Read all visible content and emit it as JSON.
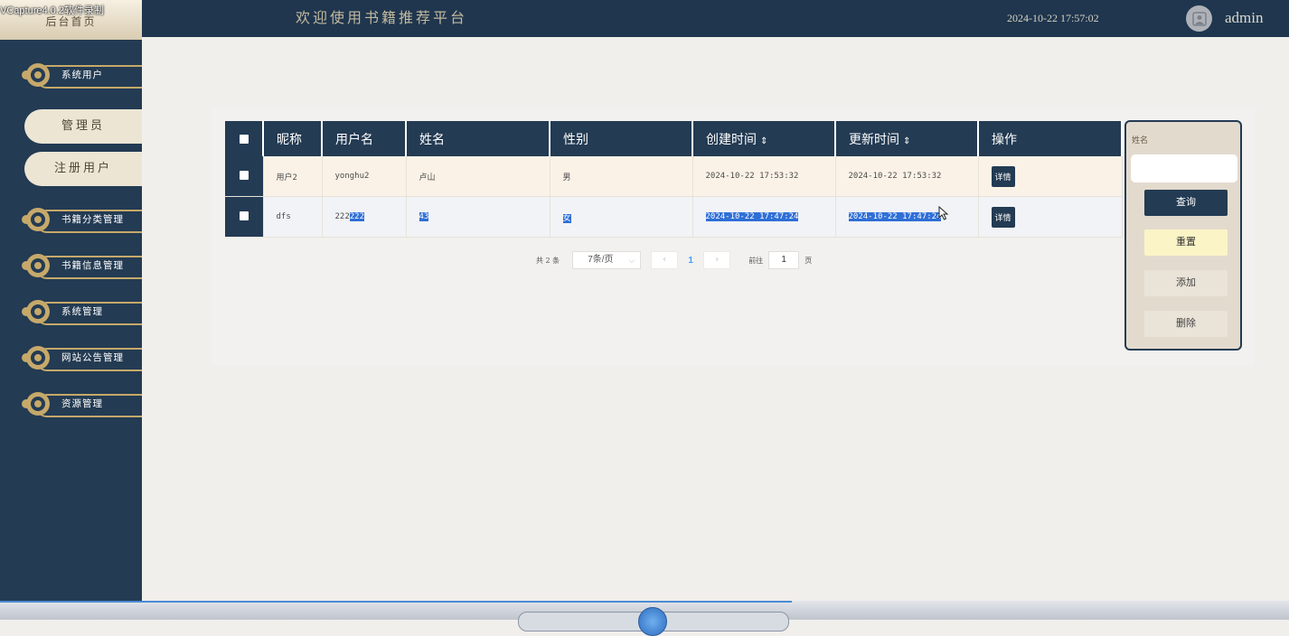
{
  "watermark": "VCapture4.0.2软件录制",
  "sidebar": {
    "home_tab": "后台首页",
    "menu": [
      {
        "label": "系统用户"
      },
      {
        "label": "书籍分类管理"
      },
      {
        "label": "书籍信息管理"
      },
      {
        "label": "系统管理"
      },
      {
        "label": "网站公告管理"
      },
      {
        "label": "资源管理"
      }
    ],
    "sub_items": [
      {
        "label": "管理员"
      },
      {
        "label": "注册用户"
      }
    ]
  },
  "header": {
    "title": "欢迎使用书籍推荐平台",
    "datetime": "2024-10-22 17:57:02",
    "username": "admin"
  },
  "table": {
    "columns": [
      "昵称",
      "用户名",
      "姓名",
      "性别",
      "创建时间",
      "更新时间",
      "操作"
    ],
    "sort_icon": "⇕",
    "rows": [
      {
        "nickname": "用户2",
        "username": "yonghu2",
        "name": "卢山",
        "gender": "男",
        "created": "2024-10-22 17:53:32",
        "updated": "2024-10-22 17:53:32",
        "action": "详情"
      },
      {
        "nickname": "dfs",
        "username_a": "222",
        "username_b": "222",
        "name": "43",
        "gender": "女",
        "created": "2024-10-22 17:47:24",
        "updated": "2024-10-22 17:47:24",
        "action": "详情"
      }
    ]
  },
  "pagination": {
    "total": "共 2 条",
    "page_size": "7条/页",
    "current_page": "1",
    "goto_label": "前往",
    "goto_value": "1",
    "page_suffix": "页"
  },
  "search_panel": {
    "label": "姓名",
    "input_value": "",
    "query": "查询",
    "reset": "重置",
    "add": "添加",
    "delete": "删除"
  },
  "colors": {
    "navy": "#233b53",
    "cream": "#ece5d4",
    "gold": "#c6a96a",
    "selection": "#2f6fd6"
  }
}
